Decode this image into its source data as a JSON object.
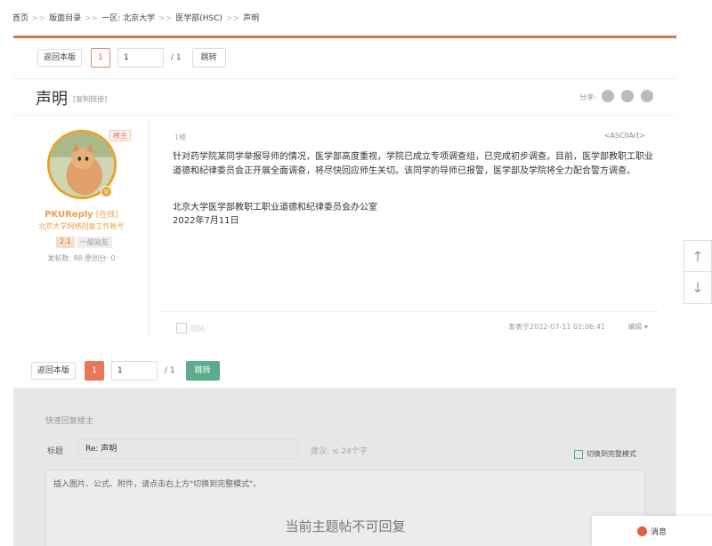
{
  "breadcrumb": {
    "items": [
      "首页",
      "版面目录",
      "一区: 北京大学",
      "医学部(HSC)",
      "声明"
    ],
    "separator": ">>"
  },
  "pager_top": {
    "back": "返回本版",
    "page": "1",
    "input": "1",
    "total": "/ 1",
    "jump": "跳转"
  },
  "pager_bottom": {
    "back": "返回本版",
    "page": "1",
    "input": "1",
    "total": "/ 1",
    "jump": "跳转"
  },
  "topic": {
    "title": "声明",
    "copy_link": "[复制链接]",
    "share_label": "分享:"
  },
  "share_icons": [
    "weibo-icon",
    "people-icon",
    "chat-bubble-icon"
  ],
  "author": {
    "host_badge": "楼主",
    "vip": "V",
    "name": "PKUReply",
    "status": "[在线]",
    "desc": "北京大学网络回复工作帐号",
    "level": "2.1",
    "rank": "一般站友",
    "stats": "发帖数: 88   原创分: 0"
  },
  "post": {
    "floor": "1楼",
    "ascii": "<ASCIIArt>",
    "body": "针对药学院某同学举报导师的情况，医学部高度重视，学院已成立专项调查组，已完成初步调查。目前，医学部教职工职业道德和纪律委员会正开展全面调查，将尽快回应师生关切。该同学的导师已报警，医学部及学院将全力配合警方调查。",
    "sig_line1": "北京大学医学部教职工职业道德和纪律委员会办公室",
    "sig_line2": "2022年7月11日",
    "reply": "回帖",
    "posted_at": "发表于2022-07-11 02:06:41",
    "edit": "编辑 ▾"
  },
  "quick_reply": {
    "heading": "快速回复楼主",
    "title_label": "标题",
    "title_value": "Re: 声明",
    "hint": "建议: ≤ 24个字",
    "switch": "切换到完整模式",
    "placeholder": "插入图片、公式、附件，请点击右上方\"切换到完整模式\"。",
    "closed": "当前主题帖不可回复"
  },
  "side": {
    "up": "↑",
    "down": "↓"
  },
  "message": {
    "label": "消息"
  },
  "colors": {
    "accent": "#e8785c",
    "green": "#5bab8c",
    "gold": "#e8a24c"
  }
}
